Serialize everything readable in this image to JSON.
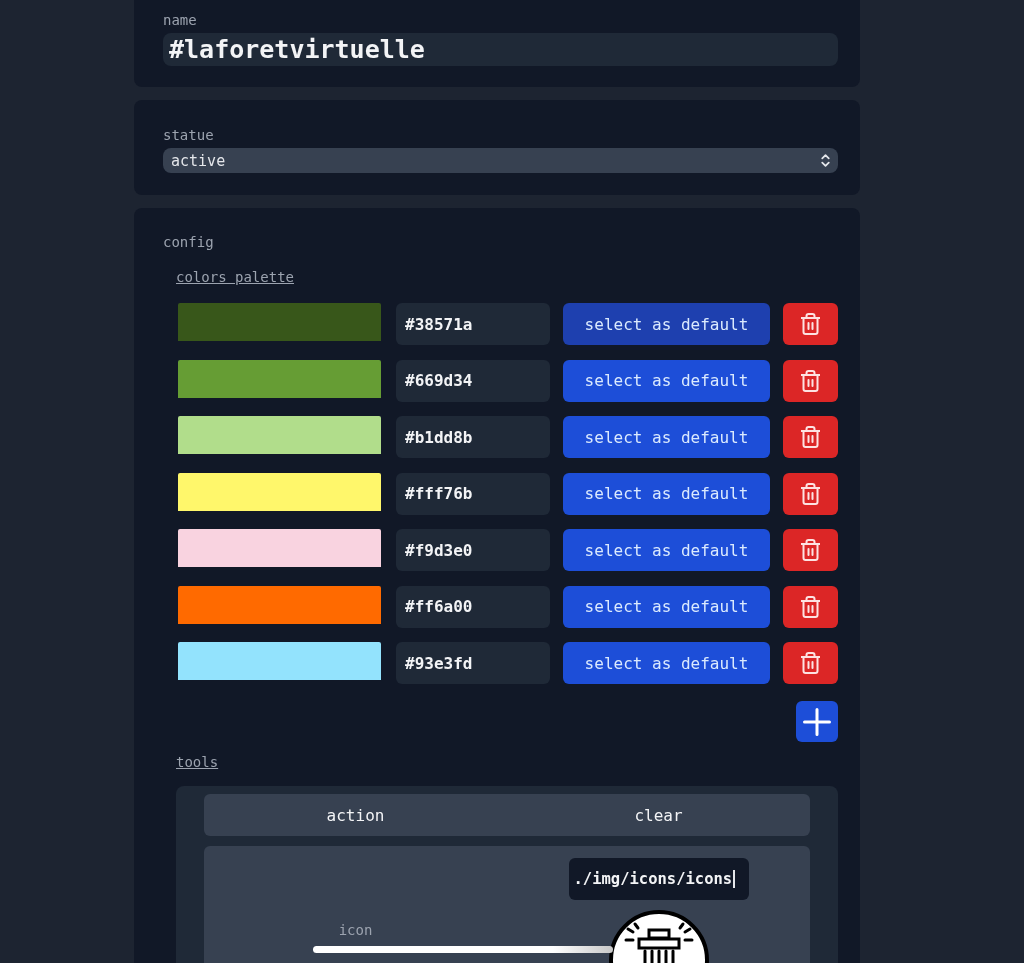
{
  "name_field": {
    "label": "name",
    "value": "#laforetvirtuelle"
  },
  "status_field": {
    "label": "statue",
    "value": "active"
  },
  "config": {
    "label": "config",
    "palette": {
      "title": "colors palette",
      "colors": [
        {
          "color": "#38571a",
          "hex": "#38571a",
          "button": "select as default",
          "selected": true
        },
        {
          "color": "#669d34",
          "hex": "#669d34",
          "button": "select as default",
          "selected": false
        },
        {
          "color": "#b1dd8b",
          "hex": "#b1dd8b",
          "button": "select as default",
          "selected": false
        },
        {
          "color": "#fff76b",
          "hex": "#fff76b",
          "button": "select as default",
          "selected": false
        },
        {
          "color": "#f9d3e0",
          "hex": "#f9d3e0",
          "button": "select as default",
          "selected": false
        },
        {
          "color": "#ff6a00",
          "hex": "#ff6a00",
          "button": "select as default",
          "selected": false
        },
        {
          "color": "#93e3fd",
          "hex": "#93e3fd",
          "button": "select as default",
          "selected": false
        }
      ]
    },
    "tools": {
      "title": "tools",
      "columns": [
        "action",
        "clear"
      ],
      "rows": [
        {
          "label": "icon",
          "path": "./img/icons/icons"
        }
      ]
    }
  }
}
